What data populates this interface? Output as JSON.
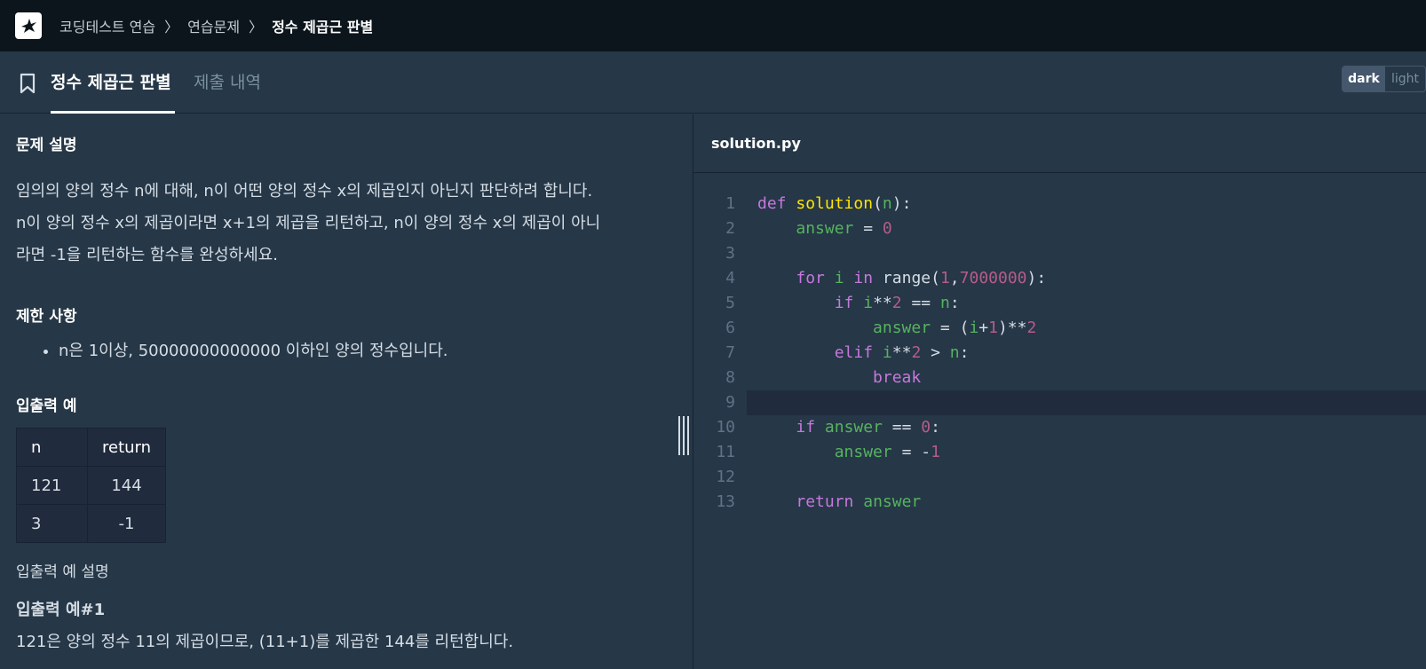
{
  "breadcrumb": {
    "items": [
      "코딩테스트 연습",
      "연습문제",
      "정수 제곱근 판별"
    ]
  },
  "tabs": {
    "active": "정수 제곱근 판별",
    "inactive": "제출 내역"
  },
  "theme": {
    "dark": "dark",
    "light": "light"
  },
  "problem": {
    "desc_title": "문제 설명",
    "desc_lines": [
      "임의의 양의 정수 n에 대해, n이 어떤 양의 정수 x의 제곱인지 아닌지 판단하려 합니다.",
      "n이 양의 정수 x의 제곱이라면 x+1의 제곱을 리턴하고, n이 양의 정수 x의 제곱이 아니",
      "라면 -1을 리턴하는 함수를 완성하세요."
    ],
    "limit_title": "제한 사항",
    "limits": [
      "n은 1이상, 50000000000000 이하인 양의 정수입니다."
    ],
    "io_title": "입출력 예",
    "io_headers": [
      "n",
      "return"
    ],
    "io_rows": [
      [
        "121",
        "144"
      ],
      [
        "3",
        "-1"
      ]
    ],
    "io_desc_title": "입출력 예 설명",
    "example_title": "입출력 예#1",
    "example_text": "121은 양의 정수 11의 제곱이므로, (11+1)를 제곱한 144를 리턴합니다."
  },
  "editor": {
    "filename": "solution.py",
    "line_numbers": [
      "1",
      "2",
      "3",
      "4",
      "5",
      "6",
      "7",
      "8",
      "9",
      "10",
      "11",
      "12",
      "13"
    ],
    "highlight_line": 9
  },
  "colors": {
    "keyword": "#c678dd",
    "function": "#ffe500",
    "variable": "#56b35f",
    "number": "#b55c8a"
  }
}
